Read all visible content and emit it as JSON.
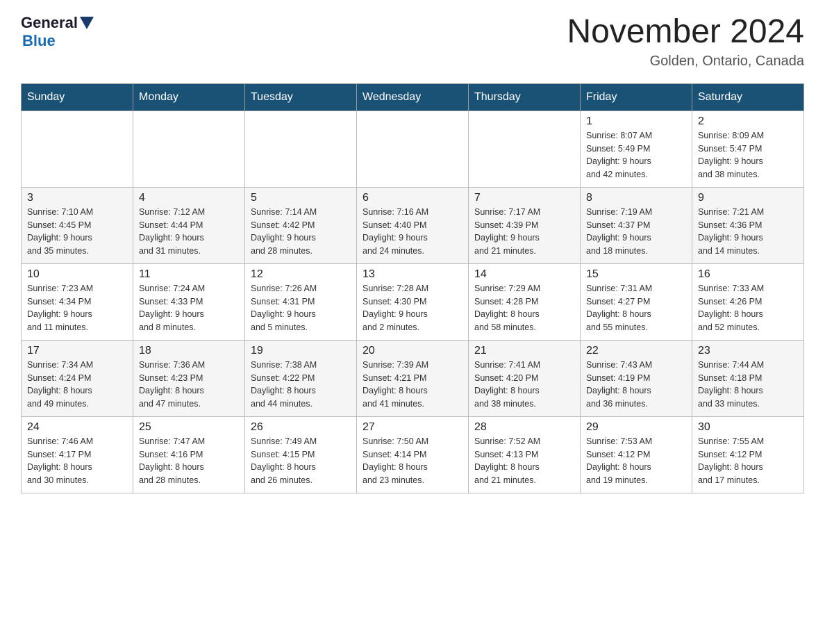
{
  "logo": {
    "general": "General",
    "blue": "Blue"
  },
  "title": "November 2024",
  "location": "Golden, Ontario, Canada",
  "days_of_week": [
    "Sunday",
    "Monday",
    "Tuesday",
    "Wednesday",
    "Thursday",
    "Friday",
    "Saturday"
  ],
  "weeks": [
    [
      {
        "day": "",
        "info": ""
      },
      {
        "day": "",
        "info": ""
      },
      {
        "day": "",
        "info": ""
      },
      {
        "day": "",
        "info": ""
      },
      {
        "day": "",
        "info": ""
      },
      {
        "day": "1",
        "info": "Sunrise: 8:07 AM\nSunset: 5:49 PM\nDaylight: 9 hours\nand 42 minutes."
      },
      {
        "day": "2",
        "info": "Sunrise: 8:09 AM\nSunset: 5:47 PM\nDaylight: 9 hours\nand 38 minutes."
      }
    ],
    [
      {
        "day": "3",
        "info": "Sunrise: 7:10 AM\nSunset: 4:45 PM\nDaylight: 9 hours\nand 35 minutes."
      },
      {
        "day": "4",
        "info": "Sunrise: 7:12 AM\nSunset: 4:44 PM\nDaylight: 9 hours\nand 31 minutes."
      },
      {
        "day": "5",
        "info": "Sunrise: 7:14 AM\nSunset: 4:42 PM\nDaylight: 9 hours\nand 28 minutes."
      },
      {
        "day": "6",
        "info": "Sunrise: 7:16 AM\nSunset: 4:40 PM\nDaylight: 9 hours\nand 24 minutes."
      },
      {
        "day": "7",
        "info": "Sunrise: 7:17 AM\nSunset: 4:39 PM\nDaylight: 9 hours\nand 21 minutes."
      },
      {
        "day": "8",
        "info": "Sunrise: 7:19 AM\nSunset: 4:37 PM\nDaylight: 9 hours\nand 18 minutes."
      },
      {
        "day": "9",
        "info": "Sunrise: 7:21 AM\nSunset: 4:36 PM\nDaylight: 9 hours\nand 14 minutes."
      }
    ],
    [
      {
        "day": "10",
        "info": "Sunrise: 7:23 AM\nSunset: 4:34 PM\nDaylight: 9 hours\nand 11 minutes."
      },
      {
        "day": "11",
        "info": "Sunrise: 7:24 AM\nSunset: 4:33 PM\nDaylight: 9 hours\nand 8 minutes."
      },
      {
        "day": "12",
        "info": "Sunrise: 7:26 AM\nSunset: 4:31 PM\nDaylight: 9 hours\nand 5 minutes."
      },
      {
        "day": "13",
        "info": "Sunrise: 7:28 AM\nSunset: 4:30 PM\nDaylight: 9 hours\nand 2 minutes."
      },
      {
        "day": "14",
        "info": "Sunrise: 7:29 AM\nSunset: 4:28 PM\nDaylight: 8 hours\nand 58 minutes."
      },
      {
        "day": "15",
        "info": "Sunrise: 7:31 AM\nSunset: 4:27 PM\nDaylight: 8 hours\nand 55 minutes."
      },
      {
        "day": "16",
        "info": "Sunrise: 7:33 AM\nSunset: 4:26 PM\nDaylight: 8 hours\nand 52 minutes."
      }
    ],
    [
      {
        "day": "17",
        "info": "Sunrise: 7:34 AM\nSunset: 4:24 PM\nDaylight: 8 hours\nand 49 minutes."
      },
      {
        "day": "18",
        "info": "Sunrise: 7:36 AM\nSunset: 4:23 PM\nDaylight: 8 hours\nand 47 minutes."
      },
      {
        "day": "19",
        "info": "Sunrise: 7:38 AM\nSunset: 4:22 PM\nDaylight: 8 hours\nand 44 minutes."
      },
      {
        "day": "20",
        "info": "Sunrise: 7:39 AM\nSunset: 4:21 PM\nDaylight: 8 hours\nand 41 minutes."
      },
      {
        "day": "21",
        "info": "Sunrise: 7:41 AM\nSunset: 4:20 PM\nDaylight: 8 hours\nand 38 minutes."
      },
      {
        "day": "22",
        "info": "Sunrise: 7:43 AM\nSunset: 4:19 PM\nDaylight: 8 hours\nand 36 minutes."
      },
      {
        "day": "23",
        "info": "Sunrise: 7:44 AM\nSunset: 4:18 PM\nDaylight: 8 hours\nand 33 minutes."
      }
    ],
    [
      {
        "day": "24",
        "info": "Sunrise: 7:46 AM\nSunset: 4:17 PM\nDaylight: 8 hours\nand 30 minutes."
      },
      {
        "day": "25",
        "info": "Sunrise: 7:47 AM\nSunset: 4:16 PM\nDaylight: 8 hours\nand 28 minutes."
      },
      {
        "day": "26",
        "info": "Sunrise: 7:49 AM\nSunset: 4:15 PM\nDaylight: 8 hours\nand 26 minutes."
      },
      {
        "day": "27",
        "info": "Sunrise: 7:50 AM\nSunset: 4:14 PM\nDaylight: 8 hours\nand 23 minutes."
      },
      {
        "day": "28",
        "info": "Sunrise: 7:52 AM\nSunset: 4:13 PM\nDaylight: 8 hours\nand 21 minutes."
      },
      {
        "day": "29",
        "info": "Sunrise: 7:53 AM\nSunset: 4:12 PM\nDaylight: 8 hours\nand 19 minutes."
      },
      {
        "day": "30",
        "info": "Sunrise: 7:55 AM\nSunset: 4:12 PM\nDaylight: 8 hours\nand 17 minutes."
      }
    ]
  ]
}
